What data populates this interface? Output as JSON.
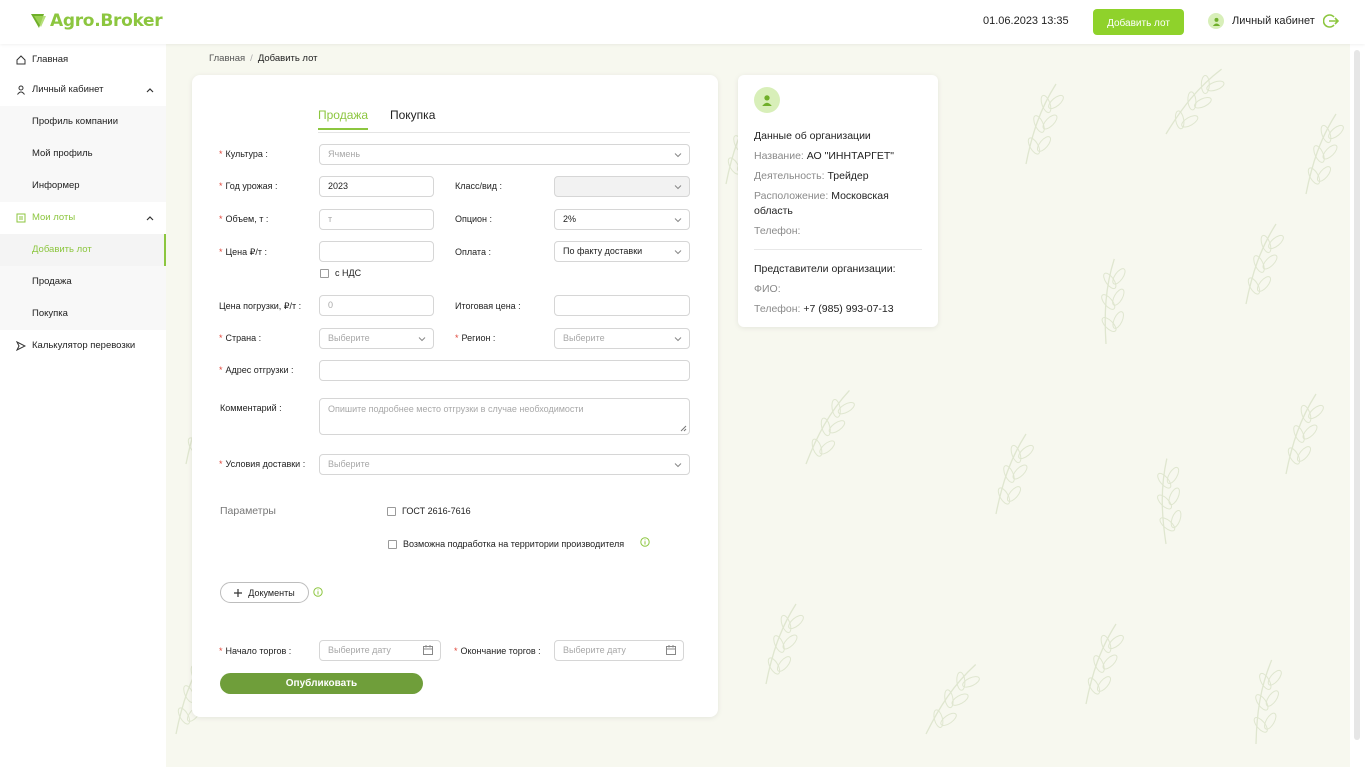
{
  "header": {
    "logo": "Agro.Broker",
    "datetime": "01.06.2023 13:35",
    "add_lot_label": "Добавить лот",
    "account_label": "Личный кабинет"
  },
  "sidebar": {
    "items": [
      {
        "label": "Главная",
        "icon": "home-icon"
      },
      {
        "label": "Личный кабинет",
        "icon": "user-icon"
      },
      {
        "label": "Профиль компании"
      },
      {
        "label": "Мой профиль"
      },
      {
        "label": "Информер"
      },
      {
        "label": "Мои лоты",
        "icon": "list-icon"
      },
      {
        "label": "Добавить лот"
      },
      {
        "label": "Продажа"
      },
      {
        "label": "Покупка"
      },
      {
        "label": "Калькулятор перевозки",
        "icon": "send-icon"
      }
    ]
  },
  "breadcrumb": {
    "home": "Главная",
    "separator": "/",
    "current": "Добавить лот"
  },
  "form": {
    "tabs": [
      "Продажа",
      "Покупка"
    ],
    "culture": {
      "label": "Культура :",
      "placeholder": "Ячмень"
    },
    "year": {
      "label": "Год урожая :",
      "value": "2023"
    },
    "class": {
      "label": "Класс/вид :",
      "value": ""
    },
    "volume": {
      "label": "Объем, т :",
      "placeholder": "т"
    },
    "option": {
      "label": "Опцион :",
      "value": "2%"
    },
    "price": {
      "label": "Цена ₽/т :",
      "value": ""
    },
    "payment": {
      "label": "Оплата :",
      "value": "По факту доставки"
    },
    "vat_label": "с НДС",
    "loading_price": {
      "label": "Цена погрузки, ₽/т :",
      "placeholder": "0"
    },
    "total_price": {
      "label": "Итоговая цена :",
      "value": ""
    },
    "country": {
      "label": "Страна :",
      "placeholder": "Выберите"
    },
    "region": {
      "label": "Регион :",
      "placeholder": "Выберите"
    },
    "address": {
      "label": "Адрес отгрузки :",
      "value": ""
    },
    "comment": {
      "label": "Комментарий :",
      "placeholder": "Опишите подробнее место отгрузки в случае необходимости"
    },
    "delivery": {
      "label": "Условия доставки :",
      "placeholder": "Выберите"
    },
    "params_title": "Параметры",
    "params": [
      "ГОСТ 2616-7616",
      "Возможна подработка на территории производителя"
    ],
    "docs_label": "Документы",
    "start": {
      "label": "Начало торгов :",
      "placeholder": "Выберите дату"
    },
    "end": {
      "label": "Окончание торгов :",
      "placeholder": "Выберите дату"
    },
    "publish_label": "Опубликовать"
  },
  "org": {
    "title": "Данные об организации",
    "name_key": "Название:",
    "name_value": "АО \"ИННТАРГЕТ\"",
    "activity_key": "Деятельность:",
    "activity_value": "Трейдер",
    "location_key": "Расположение:",
    "location_value": "Московская область",
    "phone_key": "Телефон:",
    "phone_value": "",
    "reps_title": "Представители организации:",
    "fio_key": "ФИО:",
    "fio_value": "",
    "rep_phone_key": "Телефон:",
    "rep_phone_value": "+7 (985) 993-07-13"
  },
  "colors": {
    "accent": "#8cc63f",
    "button": "#8fd22b",
    "publish": "#6f9e3a",
    "required": "#e0463a",
    "background": "#f7f8ef"
  }
}
